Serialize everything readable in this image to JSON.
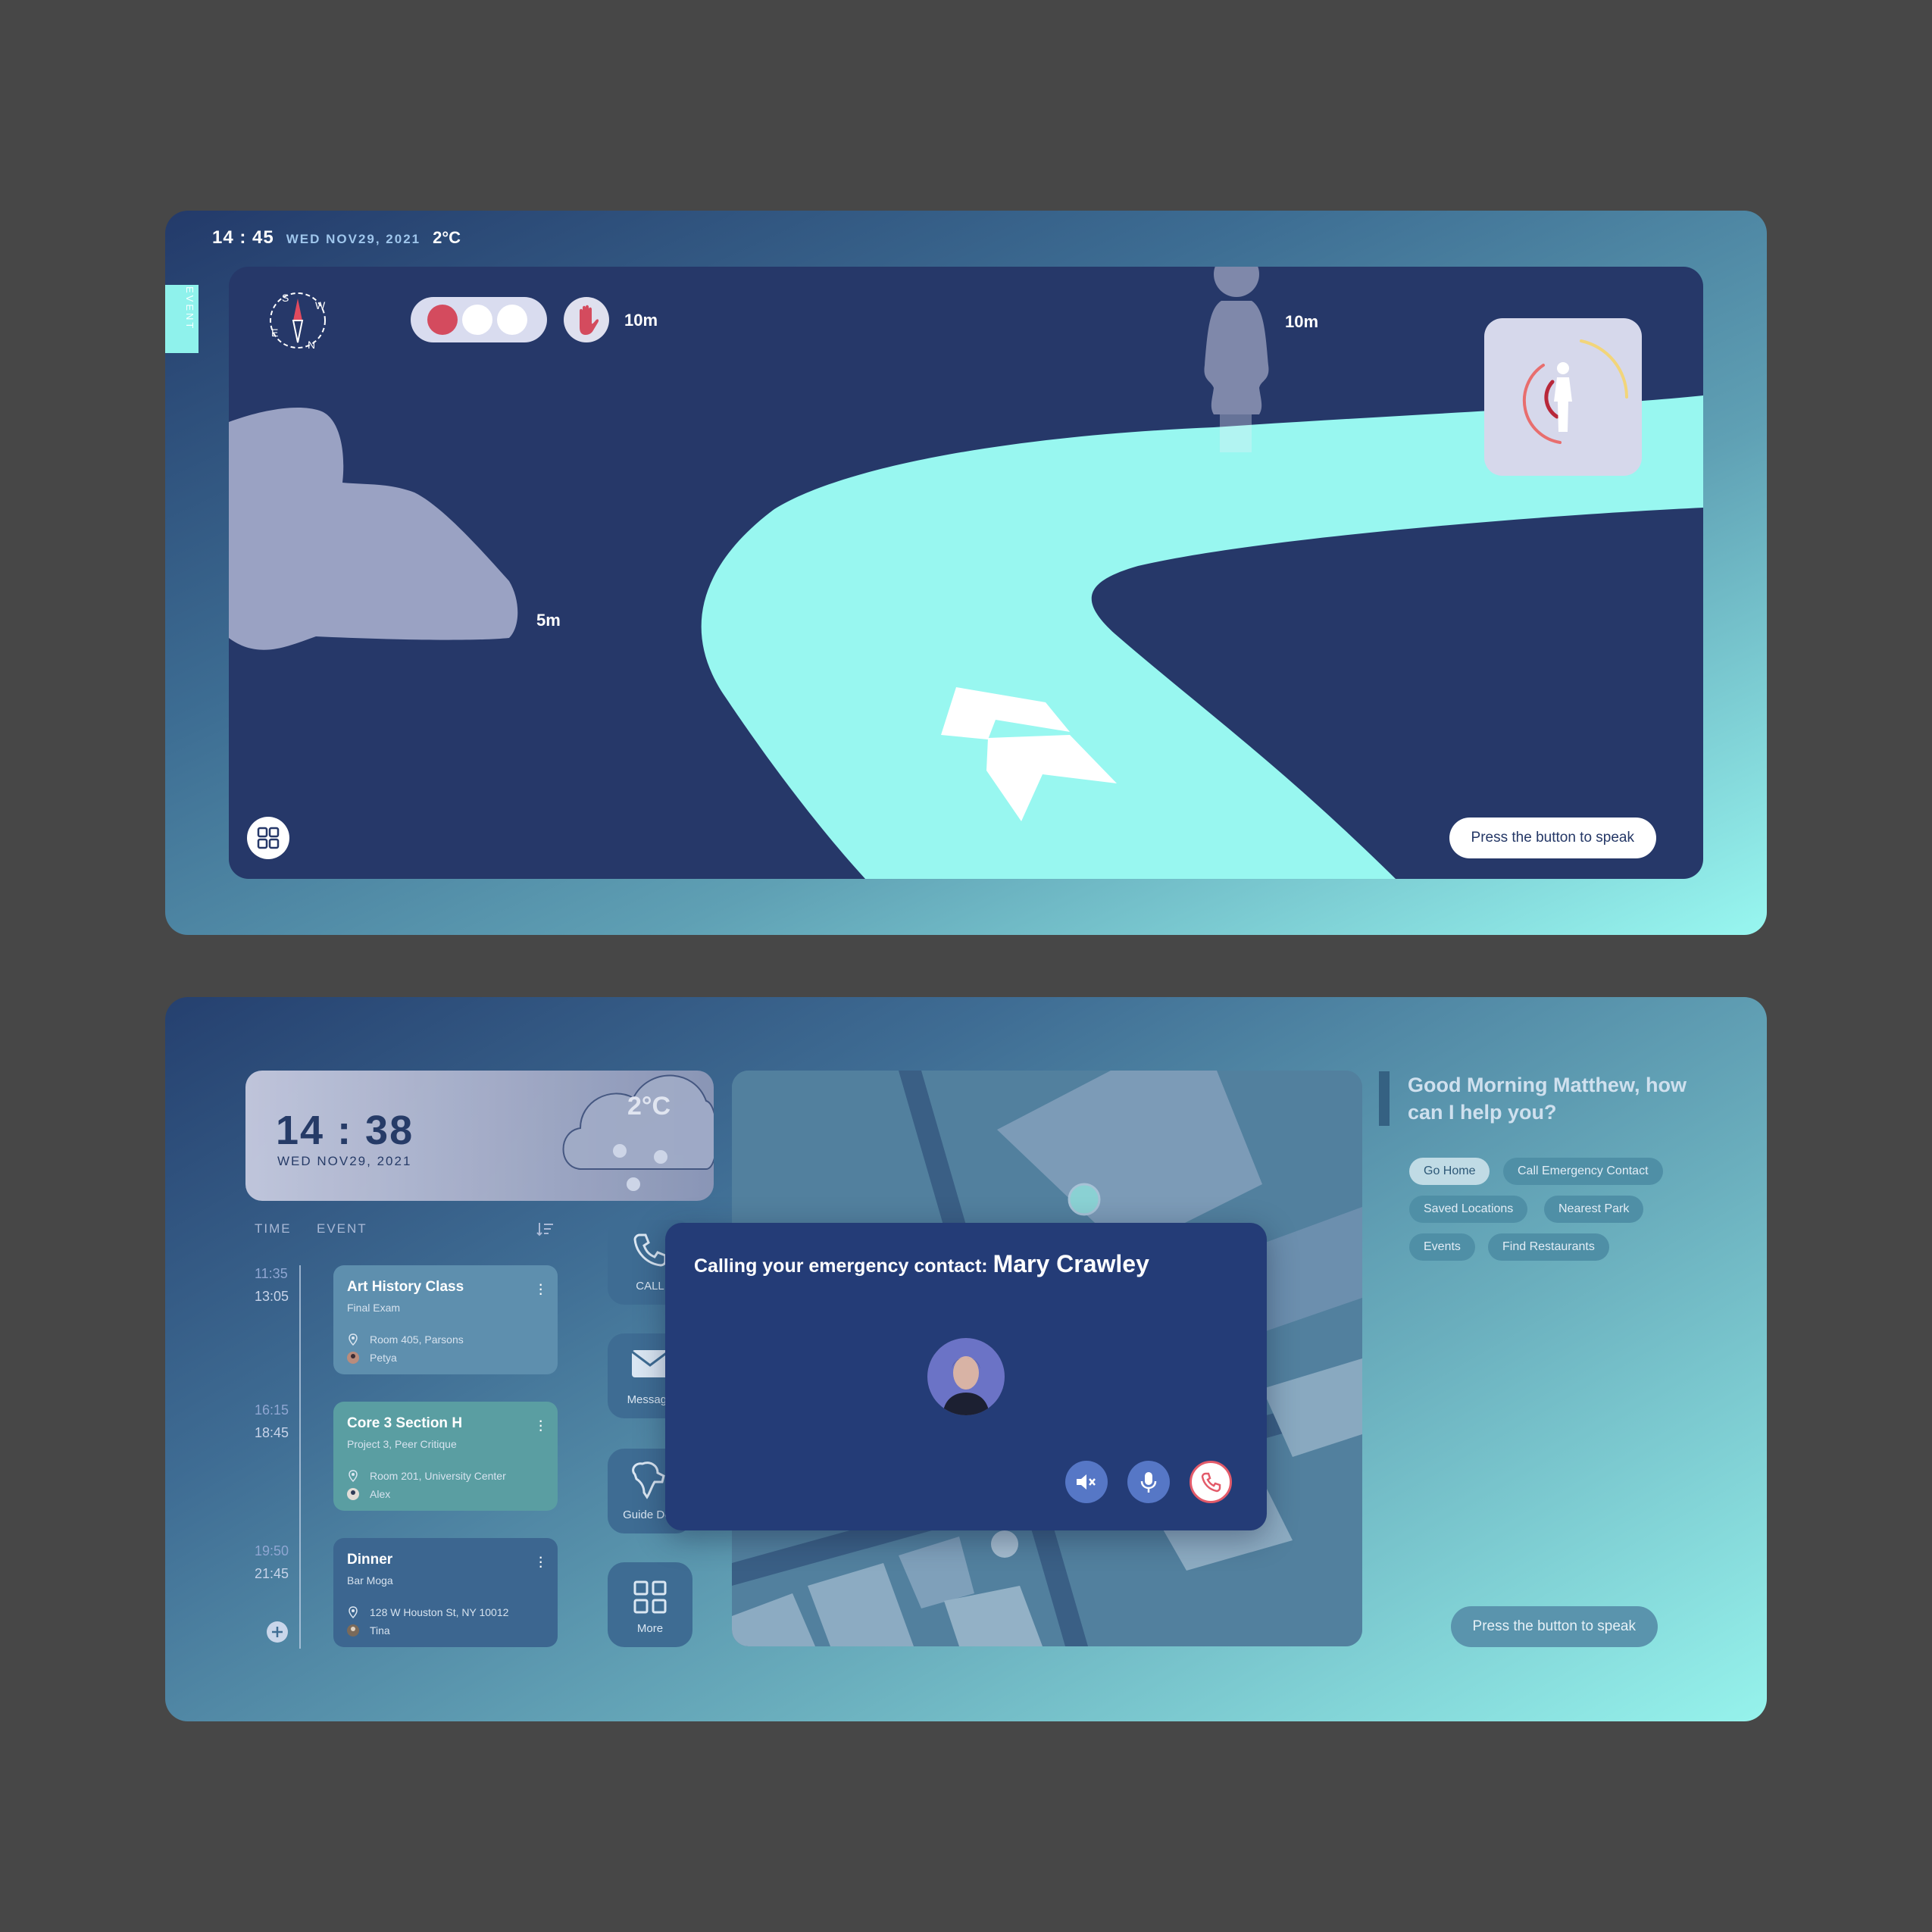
{
  "nav_screen": {
    "status": {
      "time": "14 : 45",
      "date": "WED NOV29, 2021",
      "temperature": "2°C"
    },
    "event_tab_label": "EVENT",
    "compass": {
      "letters": [
        "S",
        "W",
        "E",
        "N"
      ],
      "icon": "compass-icon"
    },
    "traffic_light": {
      "active_color": "#d44b5e",
      "icon": "stop-hand-icon"
    },
    "distances": {
      "crossing": "10m",
      "pedestrian": "10m",
      "obstacle": "5m"
    },
    "pedestrian_card_icon": "pedestrian-proximity-icon",
    "apps_button_icon": "grid-icon",
    "speak_button": "Press the button to speak",
    "colors": {
      "path": "#98f7f0",
      "screen": "#263869",
      "arrow": "#ffffff"
    }
  },
  "home_screen": {
    "clock": {
      "time": "14 : 38",
      "date": "WED NOV29, 2021",
      "temperature": "2°C"
    },
    "calendar": {
      "headers": {
        "time": "TIME",
        "event": "EVENT"
      },
      "events": [
        {
          "start": "11:35",
          "end": "13:05",
          "title": "Art History Class",
          "subtitle": "Final Exam",
          "location": "Room 405, Parsons",
          "person": "Petya",
          "color": "#5e8fae"
        },
        {
          "start": "16:15",
          "end": "18:45",
          "title": "Core 3 Section H",
          "subtitle": "Project 3, Peer Critique",
          "location": "Room 201, University Center",
          "person": "Alex",
          "color": "#5a9ea2"
        },
        {
          "start": "19:50",
          "end": "21:45",
          "title": "Dinner",
          "subtitle": "Bar Moga",
          "location": "128 W Houston St, NY 10012",
          "person": "Tina",
          "color": "#3c6690"
        }
      ]
    },
    "quick_actions": [
      {
        "label": "CALL",
        "icon": "phone-icon"
      },
      {
        "label": "Message",
        "icon": "mail-icon"
      },
      {
        "label": "Guide Dog",
        "icon": "dog-icon"
      },
      {
        "label": "More",
        "icon": "grid-icon"
      }
    ],
    "call_dialog": {
      "prefix": "Calling your emergency contact:",
      "contact": "Mary Crawley",
      "buttons": [
        "mute-speaker-icon",
        "microphone-icon",
        "end-call-icon"
      ]
    },
    "greeting": "Good Morning Matthew, how can I help you?",
    "suggestions": [
      "Go Home",
      "Call Emergency Contact",
      "Saved Locations",
      "Nearest Park",
      "Events",
      "Find Restaurants"
    ],
    "speak_button": "Press the button to speak"
  }
}
